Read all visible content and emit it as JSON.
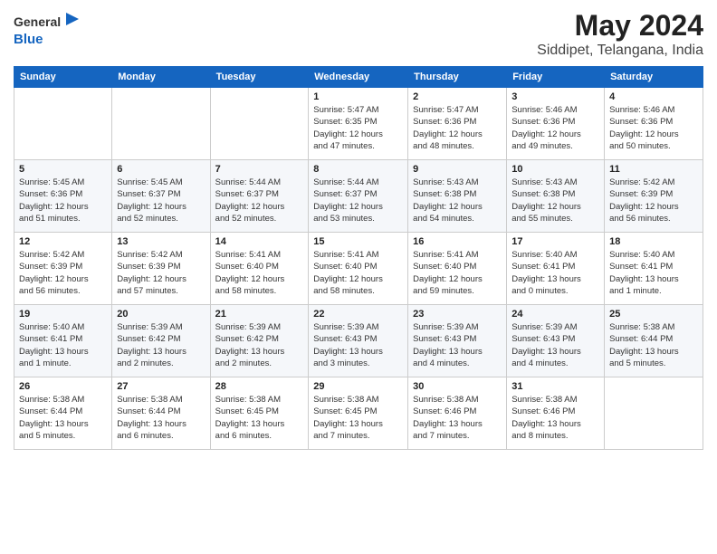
{
  "logo": {
    "general": "General",
    "blue": "Blue",
    "icon": "▶"
  },
  "title": "May 2024",
  "subtitle": "Siddipet, Telangana, India",
  "days_of_week": [
    "Sunday",
    "Monday",
    "Tuesday",
    "Wednesday",
    "Thursday",
    "Friday",
    "Saturday"
  ],
  "weeks": [
    [
      {
        "day": "",
        "info": ""
      },
      {
        "day": "",
        "info": ""
      },
      {
        "day": "",
        "info": ""
      },
      {
        "day": "1",
        "info": "Sunrise: 5:47 AM\nSunset: 6:35 PM\nDaylight: 12 hours\nand 47 minutes."
      },
      {
        "day": "2",
        "info": "Sunrise: 5:47 AM\nSunset: 6:36 PM\nDaylight: 12 hours\nand 48 minutes."
      },
      {
        "day": "3",
        "info": "Sunrise: 5:46 AM\nSunset: 6:36 PM\nDaylight: 12 hours\nand 49 minutes."
      },
      {
        "day": "4",
        "info": "Sunrise: 5:46 AM\nSunset: 6:36 PM\nDaylight: 12 hours\nand 50 minutes."
      }
    ],
    [
      {
        "day": "5",
        "info": "Sunrise: 5:45 AM\nSunset: 6:36 PM\nDaylight: 12 hours\nand 51 minutes."
      },
      {
        "day": "6",
        "info": "Sunrise: 5:45 AM\nSunset: 6:37 PM\nDaylight: 12 hours\nand 52 minutes."
      },
      {
        "day": "7",
        "info": "Sunrise: 5:44 AM\nSunset: 6:37 PM\nDaylight: 12 hours\nand 52 minutes."
      },
      {
        "day": "8",
        "info": "Sunrise: 5:44 AM\nSunset: 6:37 PM\nDaylight: 12 hours\nand 53 minutes."
      },
      {
        "day": "9",
        "info": "Sunrise: 5:43 AM\nSunset: 6:38 PM\nDaylight: 12 hours\nand 54 minutes."
      },
      {
        "day": "10",
        "info": "Sunrise: 5:43 AM\nSunset: 6:38 PM\nDaylight: 12 hours\nand 55 minutes."
      },
      {
        "day": "11",
        "info": "Sunrise: 5:42 AM\nSunset: 6:39 PM\nDaylight: 12 hours\nand 56 minutes."
      }
    ],
    [
      {
        "day": "12",
        "info": "Sunrise: 5:42 AM\nSunset: 6:39 PM\nDaylight: 12 hours\nand 56 minutes."
      },
      {
        "day": "13",
        "info": "Sunrise: 5:42 AM\nSunset: 6:39 PM\nDaylight: 12 hours\nand 57 minutes."
      },
      {
        "day": "14",
        "info": "Sunrise: 5:41 AM\nSunset: 6:40 PM\nDaylight: 12 hours\nand 58 minutes."
      },
      {
        "day": "15",
        "info": "Sunrise: 5:41 AM\nSunset: 6:40 PM\nDaylight: 12 hours\nand 58 minutes."
      },
      {
        "day": "16",
        "info": "Sunrise: 5:41 AM\nSunset: 6:40 PM\nDaylight: 12 hours\nand 59 minutes."
      },
      {
        "day": "17",
        "info": "Sunrise: 5:40 AM\nSunset: 6:41 PM\nDaylight: 13 hours\nand 0 minutes."
      },
      {
        "day": "18",
        "info": "Sunrise: 5:40 AM\nSunset: 6:41 PM\nDaylight: 13 hours\nand 1 minute."
      }
    ],
    [
      {
        "day": "19",
        "info": "Sunrise: 5:40 AM\nSunset: 6:41 PM\nDaylight: 13 hours\nand 1 minute."
      },
      {
        "day": "20",
        "info": "Sunrise: 5:39 AM\nSunset: 6:42 PM\nDaylight: 13 hours\nand 2 minutes."
      },
      {
        "day": "21",
        "info": "Sunrise: 5:39 AM\nSunset: 6:42 PM\nDaylight: 13 hours\nand 2 minutes."
      },
      {
        "day": "22",
        "info": "Sunrise: 5:39 AM\nSunset: 6:43 PM\nDaylight: 13 hours\nand 3 minutes."
      },
      {
        "day": "23",
        "info": "Sunrise: 5:39 AM\nSunset: 6:43 PM\nDaylight: 13 hours\nand 4 minutes."
      },
      {
        "day": "24",
        "info": "Sunrise: 5:39 AM\nSunset: 6:43 PM\nDaylight: 13 hours\nand 4 minutes."
      },
      {
        "day": "25",
        "info": "Sunrise: 5:38 AM\nSunset: 6:44 PM\nDaylight: 13 hours\nand 5 minutes."
      }
    ],
    [
      {
        "day": "26",
        "info": "Sunrise: 5:38 AM\nSunset: 6:44 PM\nDaylight: 13 hours\nand 5 minutes."
      },
      {
        "day": "27",
        "info": "Sunrise: 5:38 AM\nSunset: 6:44 PM\nDaylight: 13 hours\nand 6 minutes."
      },
      {
        "day": "28",
        "info": "Sunrise: 5:38 AM\nSunset: 6:45 PM\nDaylight: 13 hours\nand 6 minutes."
      },
      {
        "day": "29",
        "info": "Sunrise: 5:38 AM\nSunset: 6:45 PM\nDaylight: 13 hours\nand 7 minutes."
      },
      {
        "day": "30",
        "info": "Sunrise: 5:38 AM\nSunset: 6:46 PM\nDaylight: 13 hours\nand 7 minutes."
      },
      {
        "day": "31",
        "info": "Sunrise: 5:38 AM\nSunset: 6:46 PM\nDaylight: 13 hours\nand 8 minutes."
      },
      {
        "day": "",
        "info": ""
      }
    ]
  ]
}
